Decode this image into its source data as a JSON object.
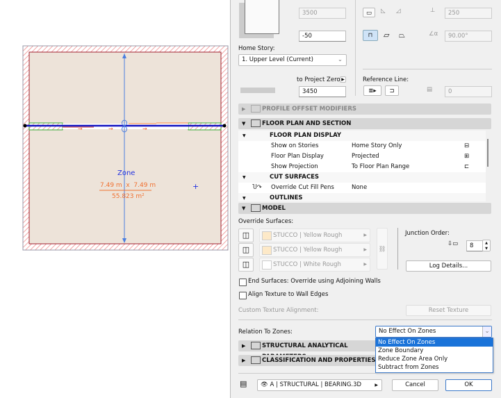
{
  "plan": {
    "zone_name": "Zone",
    "dimensions": "7.49 m  x  7.49 m",
    "area": "55.823 m²"
  },
  "dialog": {
    "height_field": "3500",
    "offset_field": "-50",
    "home_story_label": "Home Story:",
    "home_story_value": "1. Upper Level (Current)",
    "to_project_zero_label": "to Project Zero",
    "project_zero_field": "3450",
    "thickness_field": "250",
    "angle_field": "90.00°",
    "reference_line_label": "Reference Line:",
    "ref_offset_field": "0",
    "sections": {
      "profile": "PROFILE OFFSET MODIFIERS",
      "floor_plan": "FLOOR PLAN AND SECTION",
      "model": "MODEL",
      "structural": "STRUCTURAL ANALYTICAL PARAMETERS",
      "classification": "CLASSIFICATION AND PROPERTIES"
    },
    "floor_plan_table": {
      "group1": "FLOOR PLAN DISPLAY",
      "rows": [
        {
          "name": "Show on Stories",
          "value": "Home Story Only"
        },
        {
          "name": "Floor Plan Display",
          "value": "Projected"
        },
        {
          "name": "Show Projection",
          "value": "To Floor Plan Range"
        }
      ],
      "group2": "CUT SURFACES",
      "cut_row": {
        "name": "Override Cut Fill Pens",
        "value": "None"
      },
      "group3": "OUTLINES"
    },
    "model": {
      "override_label": "Override Surfaces:",
      "surfaces": [
        {
          "name": "STUCCO | Yellow Rough",
          "color": "#fde9c8"
        },
        {
          "name": "STUCCO | Yellow Rough",
          "color": "#fde9c8"
        },
        {
          "name": "STUCCO | White Rough",
          "color": "#ffffff"
        }
      ],
      "junction_label": "Junction Order:",
      "junction_value": "8",
      "log_details": "Log Details...",
      "end_surfaces": "End Surfaces: Override using Adjoining Walls",
      "align_texture": "Align Texture to Wall Edges",
      "custom_texture": "Custom Texture Alignment:",
      "reset_texture": "Reset Texture",
      "relation_label": "Relation To Zones:",
      "relation_value": "No Effect On Zones",
      "relation_options": [
        "No Effect On Zones",
        "Zone Boundary",
        "Reduce Zone Area Only",
        "Subtract from Zones"
      ]
    },
    "layer": "A | STRUCTURAL | BEARING.3D",
    "cancel": "Cancel",
    "ok": "OK"
  }
}
